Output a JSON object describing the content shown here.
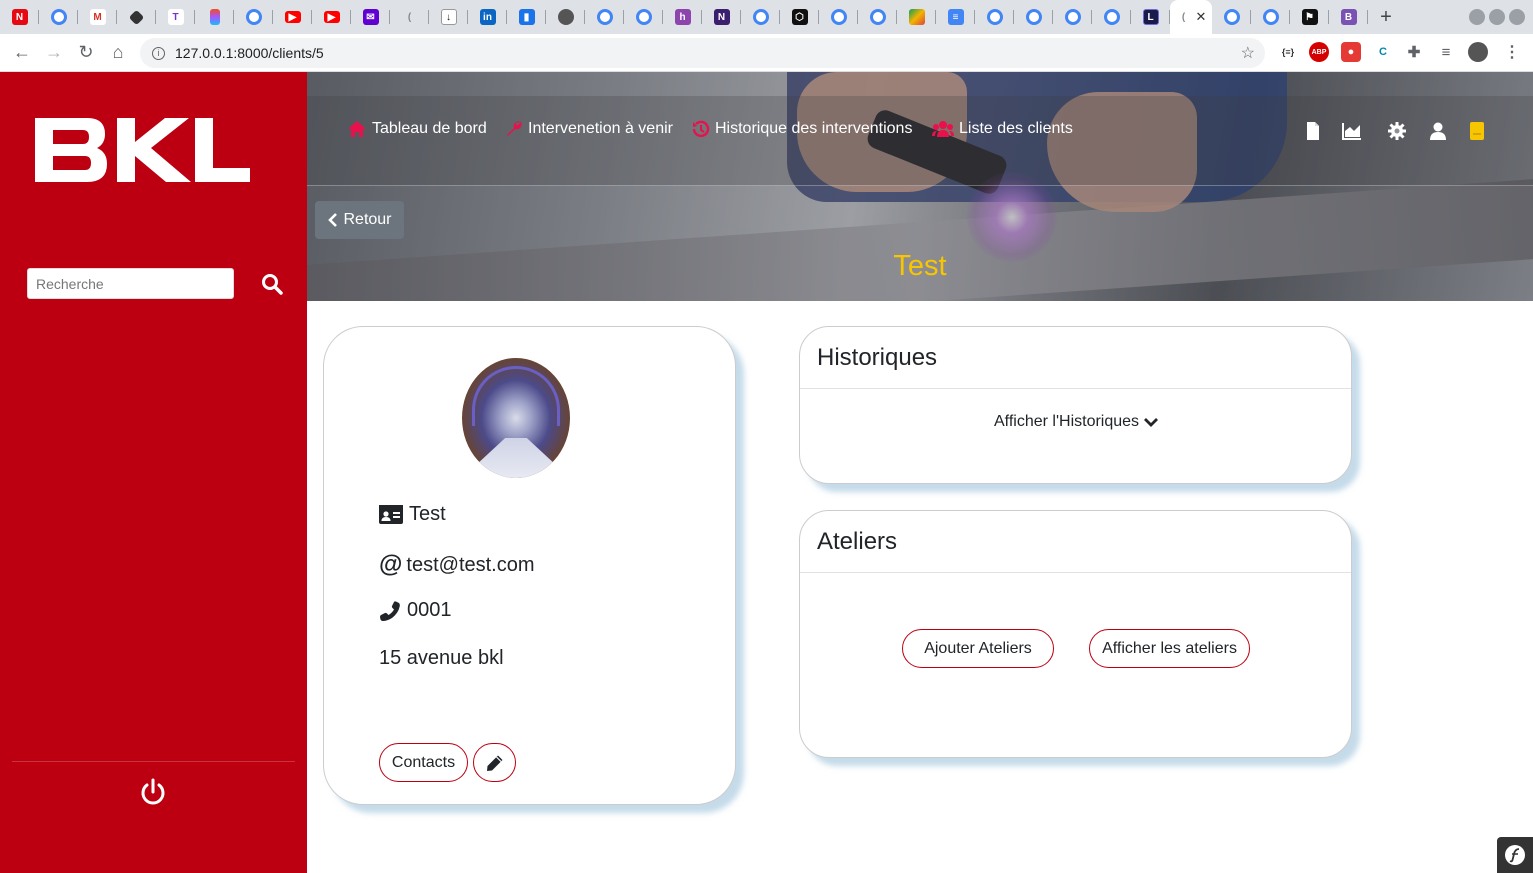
{
  "browser": {
    "url": "127.0.0.1:8000/clients/5",
    "tab_count_visible": 32,
    "new_tab_label": "+"
  },
  "sidebar": {
    "logo_text": "BKL",
    "search_placeholder": "Recherche",
    "colors": {
      "background": "#bc0011"
    }
  },
  "nav": {
    "items": [
      {
        "label": "Tableau de bord",
        "icon": "home-icon"
      },
      {
        "label": "Intervenetion à venir",
        "icon": "wrench-icon"
      },
      {
        "label": "Historique des interventions",
        "icon": "history-icon"
      },
      {
        "label": "Liste des clients",
        "icon": "users-icon"
      }
    ],
    "right_icons": [
      "file-icon",
      "chart-area-icon",
      "gear-icon",
      "user-icon",
      "sticky-note-icon"
    ],
    "icon_accent": "#e8114b"
  },
  "header": {
    "back_label": "Retour",
    "title": "Test",
    "title_color": "#f7c600"
  },
  "client": {
    "name": "Test",
    "email": "test@test.com",
    "phone": "0001",
    "address": "15 avenue bkl",
    "contacts_label": "Contacts"
  },
  "historiques": {
    "title": "Historiques",
    "toggle_label": "Afficher l'Historiques"
  },
  "ateliers": {
    "title": "Ateliers",
    "add_label": "Ajouter Ateliers",
    "show_label": "Afficher les ateliers"
  }
}
